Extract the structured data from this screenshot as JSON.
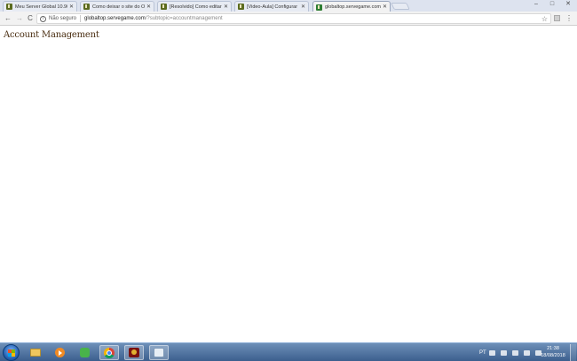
{
  "tabs": [
    {
      "title": "Meu Server Global 10.90"
    },
    {
      "title": "Como deixar o site do OT"
    },
    {
      "title": "[Resolvido] Como editar"
    },
    {
      "title": "[Video-Aula] Configurar"
    },
    {
      "title": "globaltop.servegame.com"
    }
  ],
  "toolbar": {
    "back": "←",
    "forward": "→",
    "reload": "C",
    "info_icon": "i",
    "security_label": "Não seguro",
    "url_host": "globaltop.servegame.com",
    "url_path": "/?subtopic=accountmanagement",
    "star": "☆",
    "menu": "⋮"
  },
  "window": {
    "minimize": "–",
    "maximize": "□",
    "close": "✕"
  },
  "page": {
    "heading": "Account Management"
  },
  "taskbar": {
    "language": "PT",
    "time": "21:38",
    "date": "18/08/2018"
  }
}
